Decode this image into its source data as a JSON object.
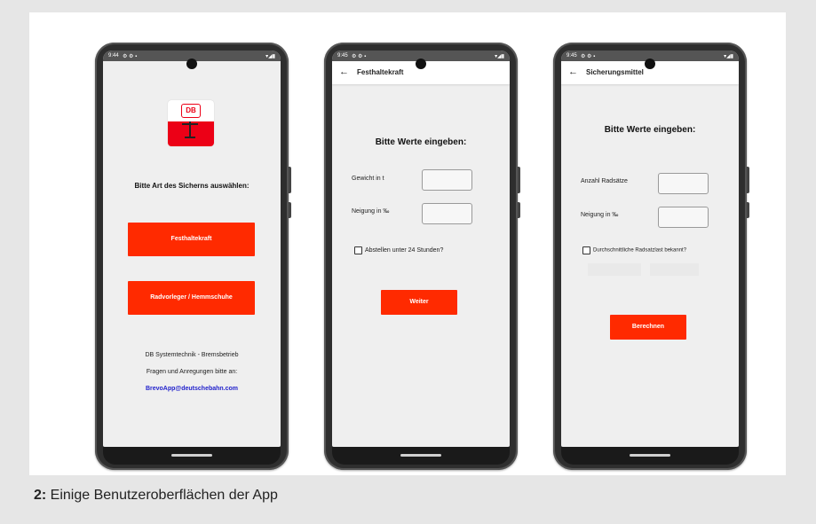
{
  "caption": {
    "number": "2:",
    "text": " Einige Benutzeroberflächen der App"
  },
  "status": {
    "time1": "9:44",
    "time2": "9:45",
    "time3": "9:45",
    "left_icons": "⚙ ⚙ ▪",
    "right_icons": "▾◢▮"
  },
  "phone1": {
    "logo_text": "DB",
    "heading": "Bitte Art des Sicherns auswählen:",
    "button1": "Festhaltekraft",
    "button2": "Radvorleger / Hemmschuhe",
    "footer1": "DB Systemtechnik - Bremsbetrieb",
    "footer2": "Fragen und Anregungen bitte an:",
    "email": "BrevoApp@deutschebahn.com"
  },
  "phone2": {
    "title": "Festhaltekraft",
    "heading": "Bitte Werte eingeben:",
    "label1": "Gewicht in t",
    "label2": "Neigung in ‰",
    "checkbox": "Abstellen unter 24 Stunden?",
    "button": "Weiter"
  },
  "phone3": {
    "title": "Sicherungsmittel",
    "heading": "Bitte Werte eingeben:",
    "label1": "Anzahl Radsätze",
    "label2": "Neigung in ‰",
    "checkbox": "Durchschnittliche Radsatzlast bekannt?",
    "button": "Berechnen"
  },
  "colors": {
    "accent": "#ff2a00",
    "db_red": "#ec0016",
    "link": "#2222cc"
  },
  "icons": {
    "back": "arrow-left-icon",
    "checkbox": "checkbox-icon"
  }
}
